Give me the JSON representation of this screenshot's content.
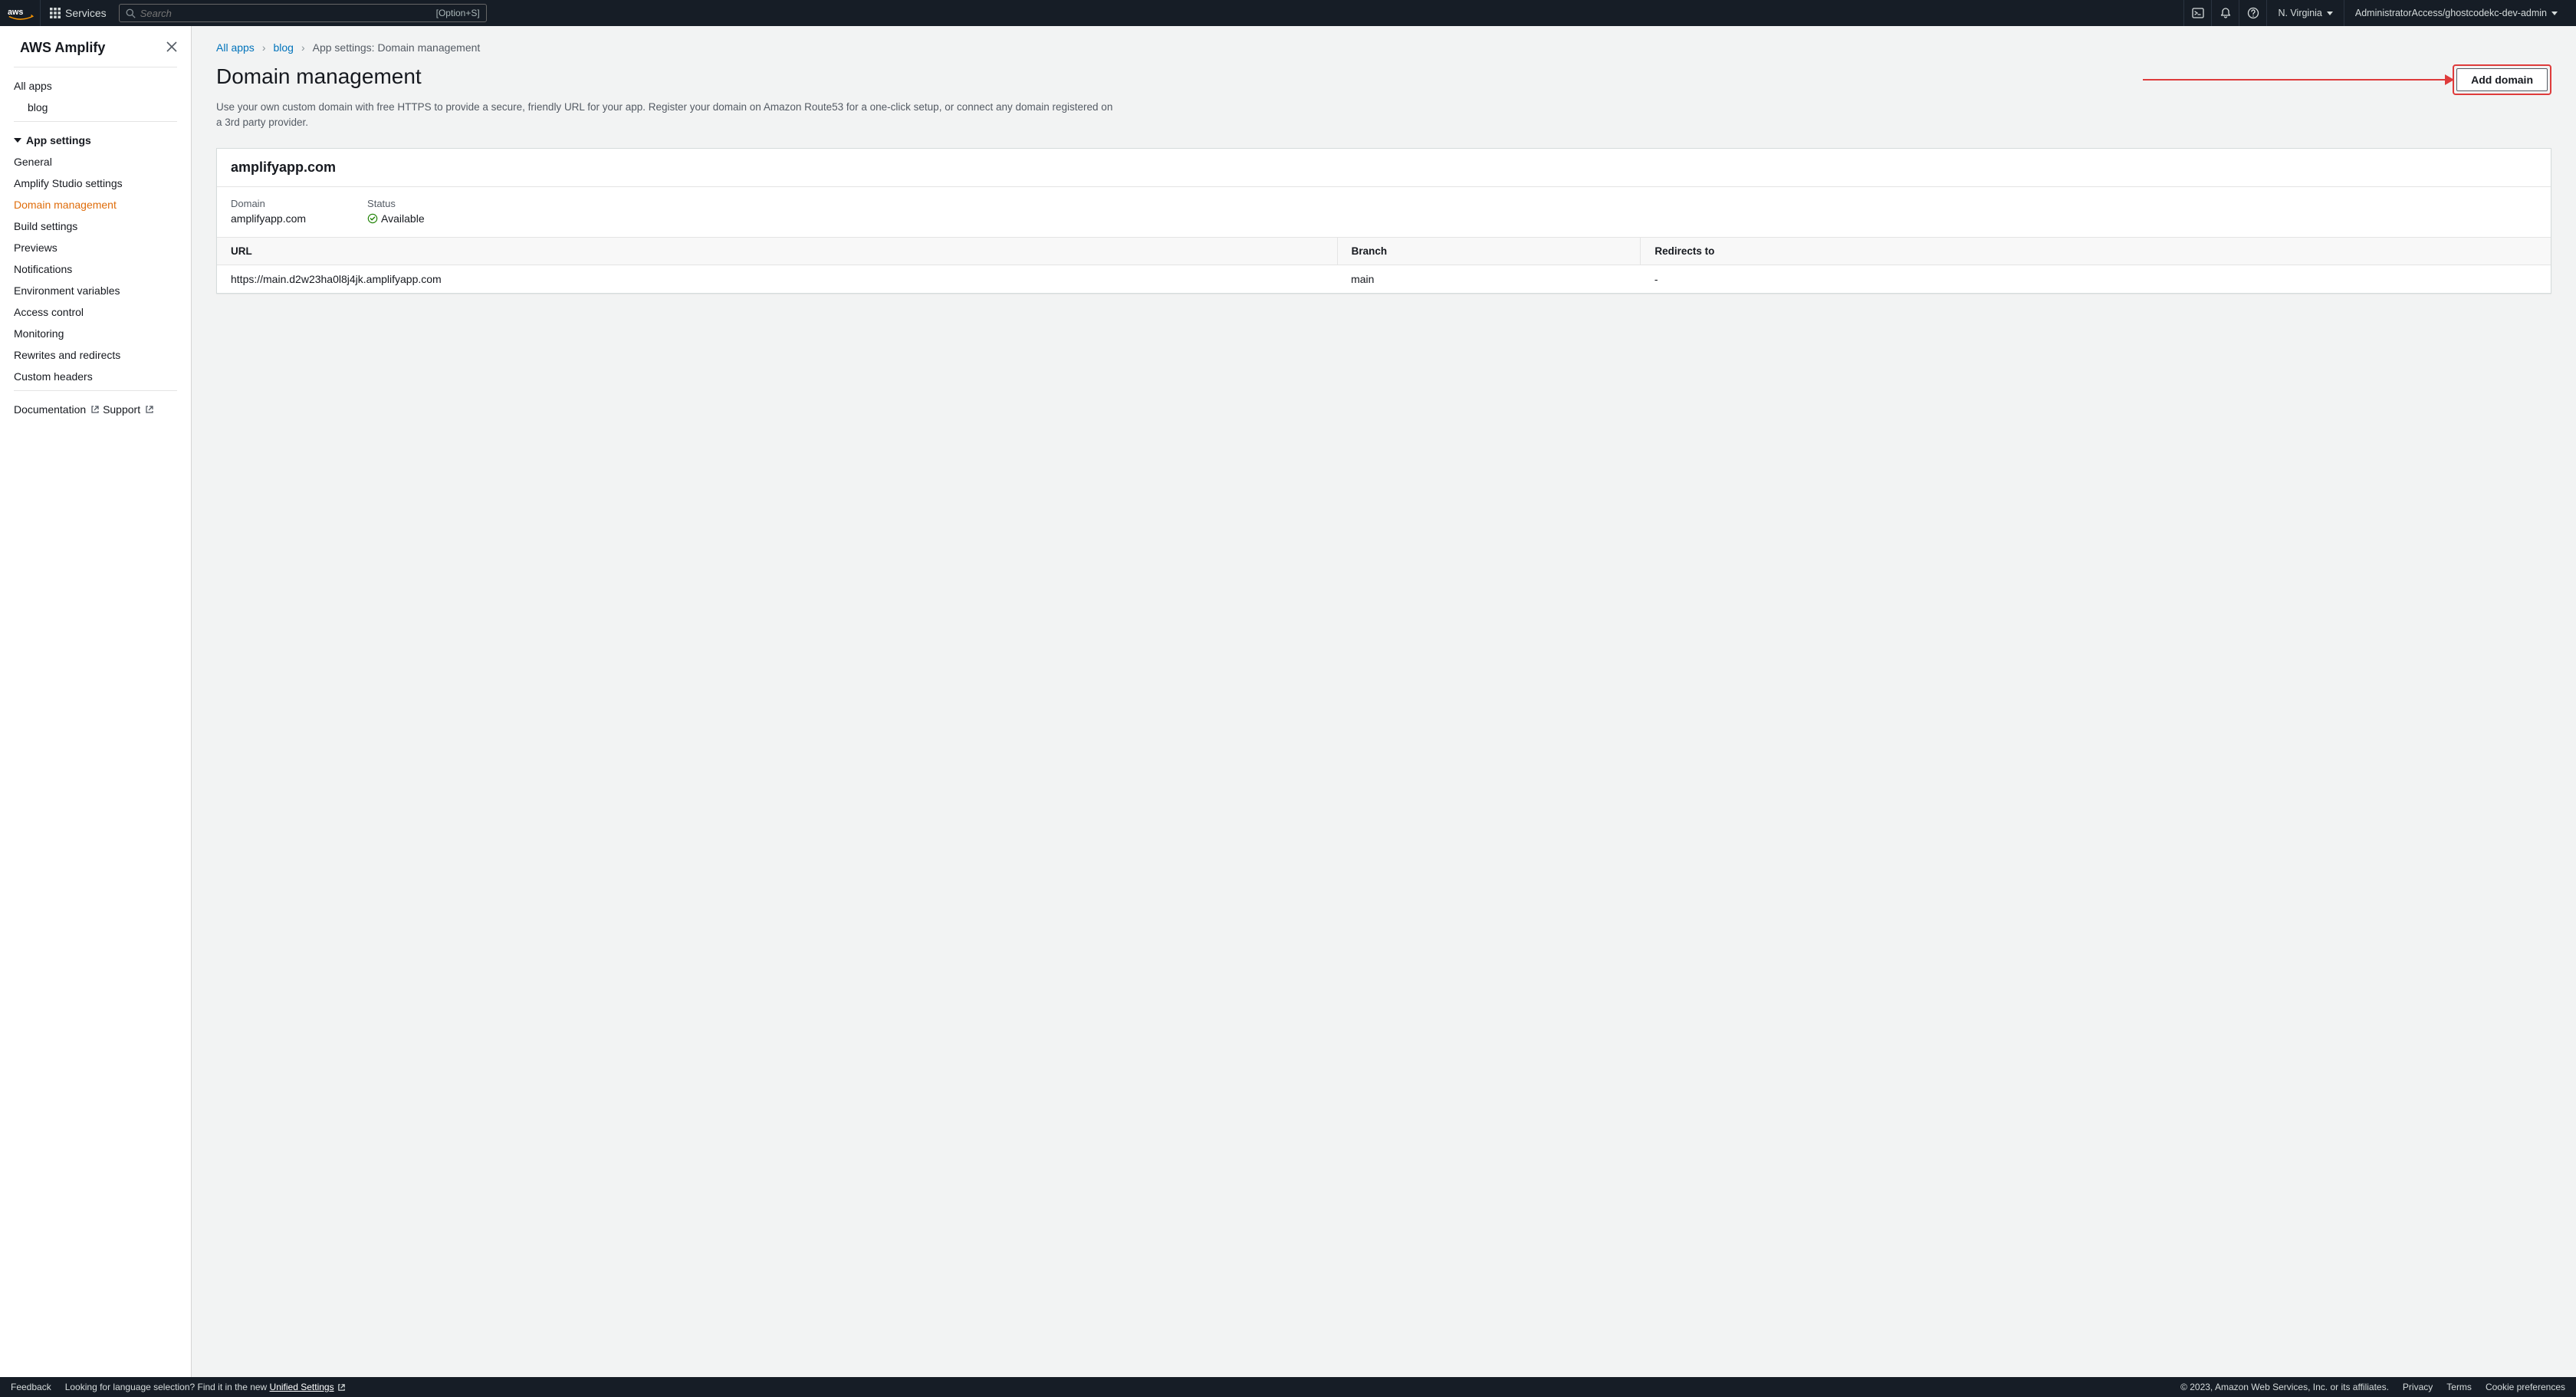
{
  "topnav": {
    "services": "Services",
    "search_placeholder": "Search",
    "search_kbd": "[Option+S]",
    "region": "N. Virginia",
    "account": "AdministratorAccess/ghostcodekc-dev-admin"
  },
  "sidebar": {
    "title": "AWS Amplify",
    "all_apps": "All apps",
    "app_name": "blog",
    "group": "App settings",
    "items": [
      "General",
      "Amplify Studio settings",
      "Domain management",
      "Build settings",
      "Previews",
      "Notifications",
      "Environment variables",
      "Access control",
      "Monitoring",
      "Rewrites and redirects",
      "Custom headers"
    ],
    "active_index": 2,
    "docs": "Documentation",
    "support": "Support"
  },
  "breadcrumb": {
    "a0": "All apps",
    "a1": "blog",
    "a2": "App settings: Domain management"
  },
  "page": {
    "heading": "Domain management",
    "desc": "Use your own custom domain with free HTTPS to provide a secure, friendly URL for your app. Register your domain on Amazon Route53 for a one-click setup, or connect any domain registered on a 3rd party provider.",
    "add_button": "Add domain"
  },
  "domain_card": {
    "name": "amplifyapp.com",
    "domain_label": "Domain",
    "domain_value": "amplifyapp.com",
    "status_label": "Status",
    "status_value": "Available",
    "columns": {
      "url": "URL",
      "branch": "Branch",
      "redirects": "Redirects to"
    },
    "rows": [
      {
        "url": "https://main.d2w23ha0l8j4jk.amplifyapp.com",
        "branch": "main",
        "redirects": "-"
      }
    ]
  },
  "footer": {
    "feedback": "Feedback",
    "lang_text": "Looking for language selection? Find it in the new ",
    "unified": "Unified Settings",
    "copyright": "© 2023, Amazon Web Services, Inc. or its affiliates.",
    "privacy": "Privacy",
    "terms": "Terms",
    "cookie": "Cookie preferences"
  }
}
